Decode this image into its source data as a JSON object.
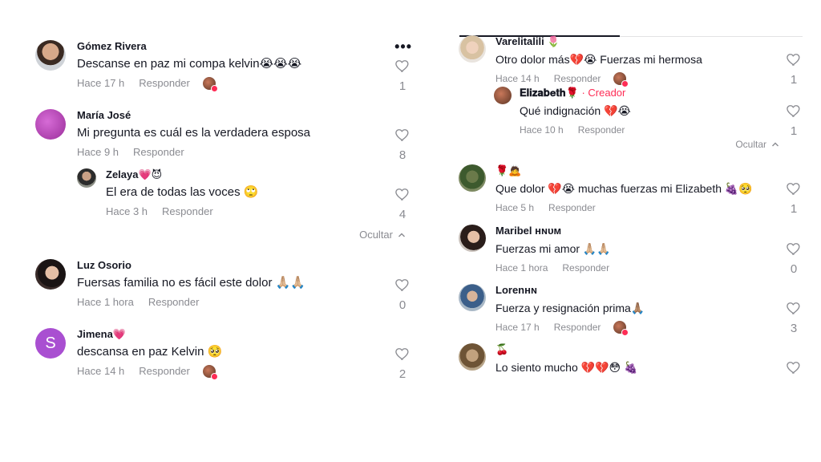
{
  "left": {
    "more_label": "•••",
    "comments": [
      {
        "user": "Gómez Rivera",
        "text": "Descanse en paz mi compa kelvin😭😭😭",
        "time": "Hace 17 h",
        "reply": "Responder",
        "likes": "1"
      },
      {
        "user": "María José",
        "text": "Mi pregunta es cuál es la verdadera esposa",
        "time": "Hace 9 h",
        "reply": "Responder",
        "likes": "8"
      },
      {
        "user": "Zelaya💗😈",
        "text": "El era de todas las voces 🙄",
        "time": "Hace 3 h",
        "reply": "Responder",
        "likes": "4"
      },
      {
        "user": "Luz Osorio",
        "text": "Fuersas familia no es fácil este dolor 🙏🏼🙏🏼",
        "time": "Hace 1 hora",
        "reply": "Responder",
        "likes": "0"
      },
      {
        "user": "Jimena💗",
        "avatar_letter": "S",
        "text": "descansa en paz Kelvin 🥺",
        "time": "Hace 14 h",
        "reply": "Responder",
        "likes": "2"
      }
    ],
    "hide_label": "Ocultar"
  },
  "right": {
    "comments": [
      {
        "user": "Varelitalili 🌷",
        "text": "Otro dolor más💔😭 Fuerzas mi hermosa",
        "time": "Hace 14 h",
        "reply": "Responder",
        "likes": "1"
      },
      {
        "user": "𝐄𝐥𝐢𝐳𝐚𝐛𝐞𝐭𝐡🌹",
        "creator": " · Creador",
        "text": "Qué indignación 💔😭",
        "time": "Hace 10 h",
        "reply": "Responder",
        "likes": "1"
      },
      {
        "user": "🌹🙇",
        "text": "Que dolor 💔😭 muchas fuerzas mi Elizabeth 🍇🥺",
        "time": "Hace 5 h",
        "reply": "Responder",
        "likes": "1"
      },
      {
        "user": "Maribel ʜɴᴜᴍ",
        "text": "Fuerzas mi amor 🙏🏼🙏🏼",
        "time": "Hace 1 hora",
        "reply": "Responder",
        "likes": "0"
      },
      {
        "user": "Lorenʜɴ",
        "text": "Fuerza y resignación prima🙏🏽",
        "time": "Hace 17 h",
        "reply": "Responder",
        "likes": "3"
      },
      {
        "user": "🍒",
        "text": "Lo siento mucho 💔💔😳 🍇",
        "time": "",
        "reply": "",
        "likes": ""
      }
    ],
    "hide_label": "Ocultar"
  },
  "colors": {
    "accent": "#fe2c55",
    "muted": "#8a8b91",
    "text": "#161823"
  }
}
